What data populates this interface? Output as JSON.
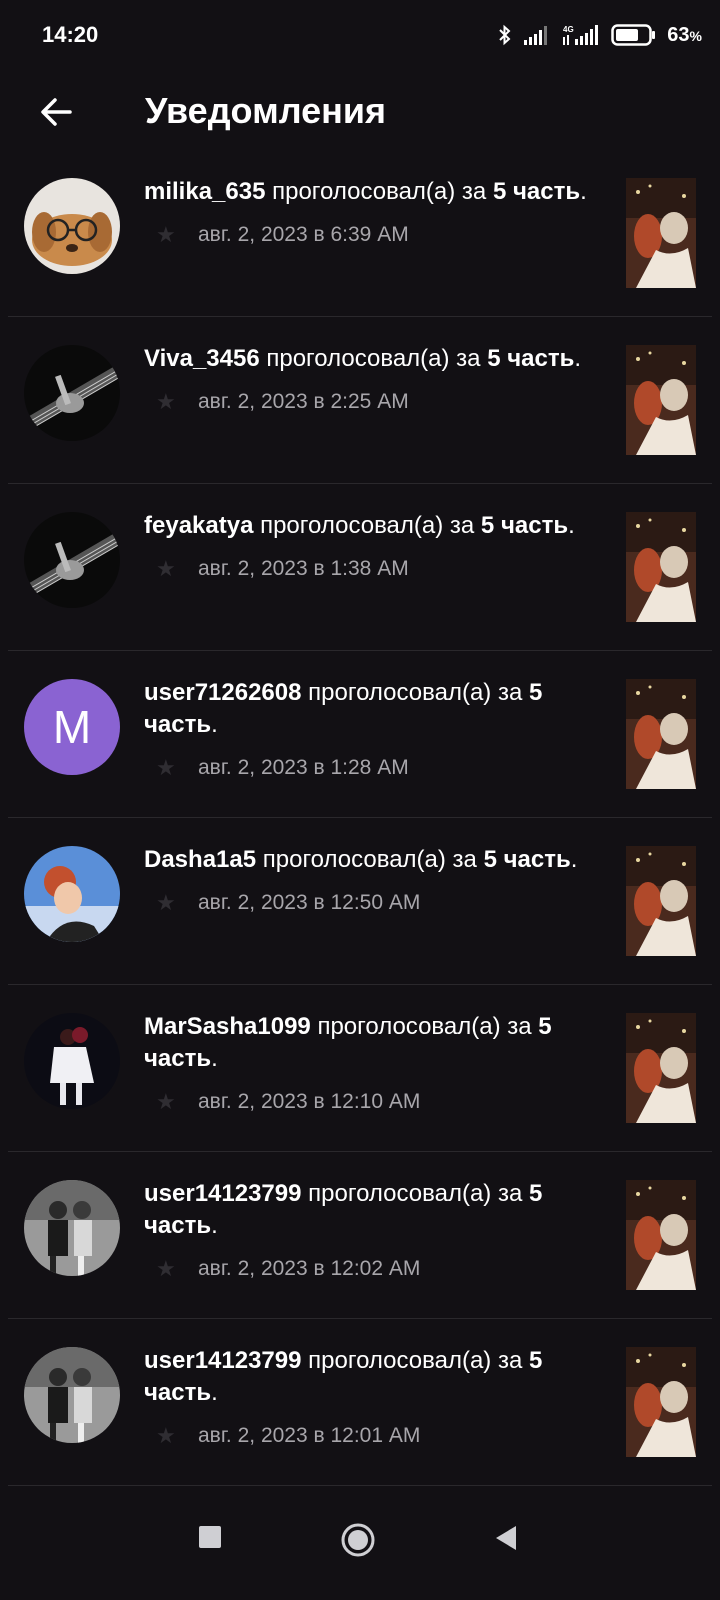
{
  "status": {
    "time": "14:20",
    "battery": "63",
    "battery_unit": "%"
  },
  "header": {
    "title": "Уведомления",
    "back_icon": "arrow-left-icon"
  },
  "notifications": [
    {
      "user": "milika_635",
      "action": " проголосовал(а) за ",
      "part": "5",
      "part_word": "часть",
      "tail": ".",
      "date": "авг. 2, 2023 в 6:39 AM",
      "avatar": "puppy-photo"
    },
    {
      "user": "Viva_3456",
      "action": " проголосовал(а) за ",
      "part": "5",
      "part_word": "часть",
      "tail": ".",
      "date": "авг. 2, 2023 в 2:25 AM",
      "avatar": "guitar-photo"
    },
    {
      "user": "feyakatya",
      "action": " проголосовал(а) за ",
      "part": "5",
      "part_word": "часть",
      "tail": ".",
      "date": "авг. 2, 2023 в 1:38 AM",
      "avatar": "guitar-photo"
    },
    {
      "user": "user71262608",
      "action": " проголосовал(а) за ",
      "part": "5",
      "part_word": "часть",
      "tail": ".",
      "date": "авг. 2, 2023 в 1:28 AM",
      "avatar": "letter",
      "avatar_letter": "M"
    },
    {
      "user": "Dasha1a5",
      "action": " проголосовал(а) за ",
      "part": "5",
      "part_word": "часть",
      "tail": ".",
      "date": "авг. 2, 2023 в 12:50 AM",
      "avatar": "woman-photo"
    },
    {
      "user": "MarSasha1099",
      "action": " проголосовал(а) за ",
      "part": "5",
      "part_word": "часть",
      "tail": ".",
      "date": "авг. 2, 2023 в 12:10 AM",
      "avatar": "skaters-photo"
    },
    {
      "user": "user14123799",
      "action": " проголосовал(а) за ",
      "part": "5",
      "part_word": "часть",
      "tail": ".",
      "date": "авг. 2, 2023 в 12:02 AM",
      "avatar": "bw-couple-photo"
    },
    {
      "user": "user14123799",
      "action": " проголосовал(а) за ",
      "part": "5",
      "part_word": "часть",
      "tail": ".",
      "date": "авг. 2, 2023 в 12:01 AM",
      "avatar": "bw-couple-photo"
    }
  ],
  "navbar": {
    "recents_icon": "square-icon",
    "home_icon": "circle-icon",
    "back_icon": "triangle-back-icon"
  },
  "colors": {
    "background": "#121014",
    "letter_avatar": "#8a63d2",
    "meta_text": "#a8a6ab"
  }
}
